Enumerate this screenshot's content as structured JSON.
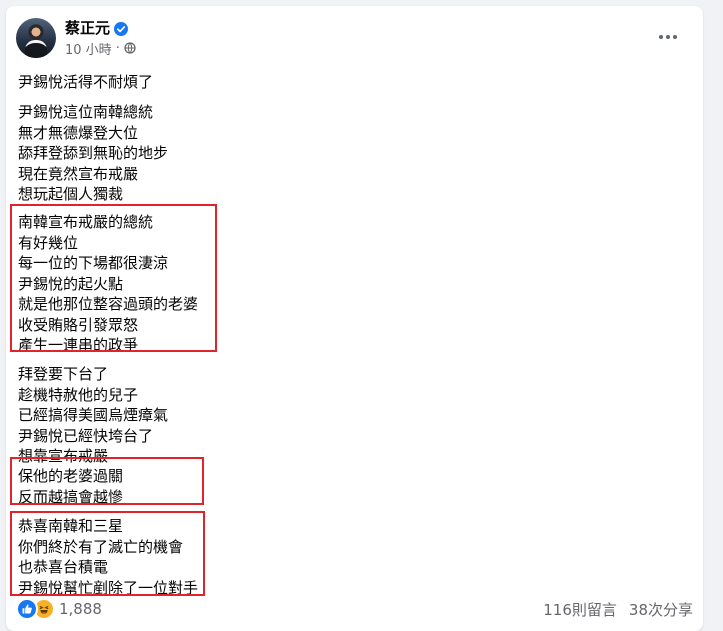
{
  "author": {
    "name": "蔡正元",
    "verified": true
  },
  "post_meta": {
    "time": "10 小時",
    "separator": "·",
    "audience_icon": "globe-icon"
  },
  "post": {
    "title": "尹錫悅活得不耐煩了",
    "paragraph1": [
      "尹錫悅這位南韓總統",
      "無才無德爆登大位",
      "舔拜登舔到無恥的地步",
      "現在竟然宣布戒嚴",
      "想玩起個人獨裁"
    ],
    "paragraph2": [
      "南韓宣布戒嚴的總統",
      "有好幾位",
      "每一位的下場都很淒涼",
      "尹錫悅的起火點",
      "就是他那位整容過頭的老婆",
      "收受賄賂引發眾怒",
      "產生一連串的政爭"
    ],
    "paragraph3": [
      "拜登要下台了",
      "趁機特赦他的兒子",
      "已經搞得美國烏煙瘴氣",
      "尹錫悅已經快垮台了",
      "想靠宣布戒嚴"
    ],
    "paragraph4": [
      "保他的老婆過關",
      "反而越搞會越慘"
    ],
    "paragraph5": [
      "恭喜南韓和三星",
      "你們終於有了滅亡的機會",
      "也恭喜台積電",
      "尹錫悅幫忙剷除了一位對手"
    ]
  },
  "footer": {
    "reaction_icons": [
      "like-icon",
      "haha-icon"
    ],
    "reaction_count": "1,888",
    "comments": "116則留言",
    "shares": "38次分享"
  },
  "colors": {
    "highlight_border": "#e0242b",
    "verified_blue": "#1877f2",
    "secondary_text": "#65676b"
  }
}
